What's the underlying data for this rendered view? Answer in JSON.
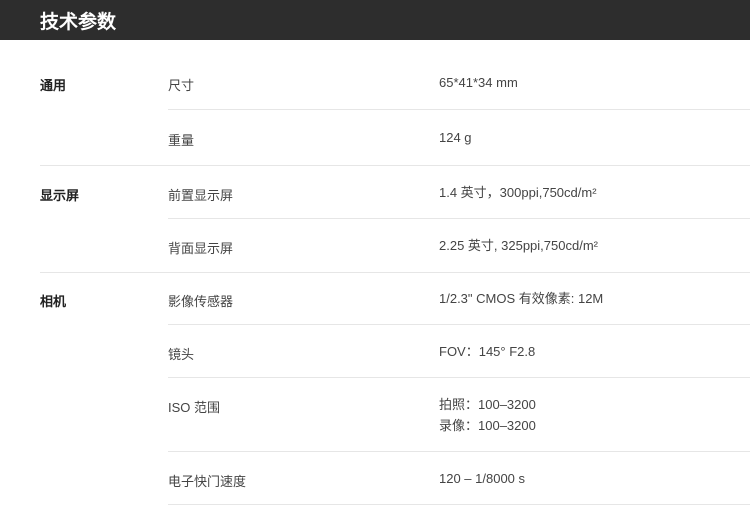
{
  "page_title": "技术参数",
  "groups": [
    {
      "label": "通用",
      "rows": [
        {
          "name": "尺寸",
          "value_lines": [
            "65*41*34 mm"
          ]
        },
        {
          "name": "重量",
          "value_lines": [
            "124 g"
          ]
        }
      ]
    },
    {
      "label": "显示屏",
      "rows": [
        {
          "name": "前置显示屏",
          "value_lines": [
            "1.4 英寸，300ppi,750cd/m²"
          ]
        },
        {
          "name": "背面显示屏",
          "value_lines": [
            "2.25 英寸, 325ppi,750cd/m²"
          ]
        }
      ]
    },
    {
      "label": "相机",
      "rows": [
        {
          "name": "影像传感器",
          "value_lines": [
            "1/2.3\" CMOS  有效像素: 12M"
          ]
        },
        {
          "name": "镜头",
          "value_lines": [
            "FOV：145° F2.8"
          ]
        },
        {
          "name": "ISO 范围",
          "value_lines": [
            "拍照：100–3200",
            "录像：100–3200"
          ]
        },
        {
          "name": "电子快门速度",
          "value_lines": [
            "120 – 1/8000 s"
          ]
        }
      ]
    }
  ]
}
